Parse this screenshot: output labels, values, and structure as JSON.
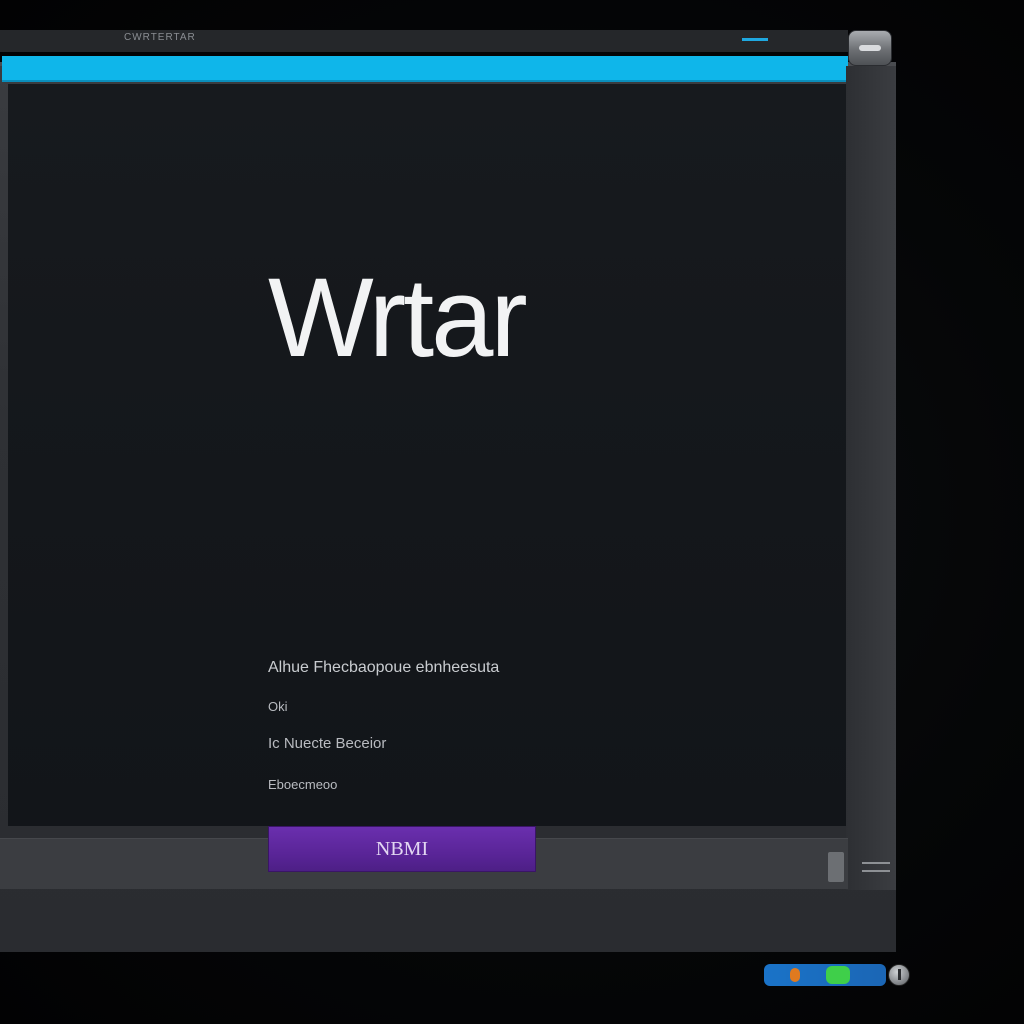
{
  "window": {
    "titlebar_text": "CWRTERTAR"
  },
  "main": {
    "app_title": "Wrtar",
    "info_lines": [
      "Alhue Fhecbaopoue ebnheesuta",
      "Oki",
      "Ic Nuecte Beceior",
      "Eboecmeoo"
    ],
    "submit_label": "NBMI"
  },
  "icons": {
    "tray": [
      "orange-indicator-icon",
      "green-indicator-icon",
      "power-icon"
    ]
  },
  "colors": {
    "accent_bar": "#0fb6ea",
    "button": "#5a2598",
    "background": "#14171b"
  }
}
